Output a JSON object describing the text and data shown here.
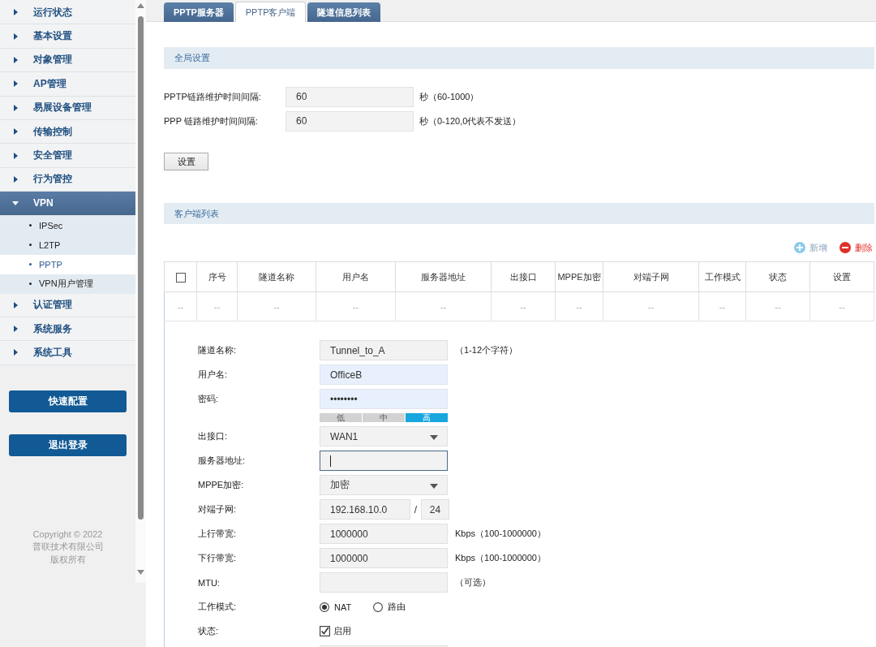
{
  "sidebar": {
    "items": [
      {
        "label": "运行状态",
        "expanded": false
      },
      {
        "label": "基本设置",
        "expanded": false
      },
      {
        "label": "对象管理",
        "expanded": false
      },
      {
        "label": "AP管理",
        "expanded": false
      },
      {
        "label": "易展设备管理",
        "expanded": false
      },
      {
        "label": "传输控制",
        "expanded": false
      },
      {
        "label": "安全管理",
        "expanded": false
      },
      {
        "label": "行为管控",
        "expanded": false
      },
      {
        "label": "VPN",
        "expanded": true,
        "children": [
          {
            "label": "IPSec",
            "selected": false
          },
          {
            "label": "L2TP",
            "selected": false
          },
          {
            "label": "PPTP",
            "selected": true
          },
          {
            "label": "VPN用户管理",
            "selected": false
          }
        ]
      },
      {
        "label": "认证管理",
        "expanded": false
      },
      {
        "label": "系统服务",
        "expanded": false
      },
      {
        "label": "系统工具",
        "expanded": false
      }
    ],
    "buttons": [
      "快速配置",
      "退出登录"
    ],
    "copyright": [
      "Copyright © 2022",
      "普联技术有限公司",
      "版权所有"
    ]
  },
  "tabs": [
    {
      "label": "PPTP服务器",
      "selected": false
    },
    {
      "label": "PPTP客户端",
      "selected": true
    },
    {
      "label": "隧道信息列表",
      "selected": false
    }
  ],
  "global_settings": {
    "title": "全局设置",
    "fields": [
      {
        "label": "PPTP链路维护时间间隔:",
        "value": "60",
        "hint": "秒（60-1000）"
      },
      {
        "label": "PPP 链路维护时间间隔:",
        "value": "60",
        "hint": "秒（0-120,0代表不发送）"
      }
    ],
    "button": "设置"
  },
  "client_list": {
    "title": "客户端列表",
    "actions": [
      {
        "kind": "add",
        "label": "新增"
      },
      {
        "kind": "delete",
        "label": "删除"
      }
    ],
    "table": {
      "select_all_checked": false,
      "columns": [
        "序号",
        "隧道名称",
        "用户名",
        "服务器地址",
        "出接口",
        "MPPE加密",
        "对端子网",
        "工作模式",
        "状态",
        "设置"
      ],
      "rows": [
        {
          "check_cell": "--",
          "cells": [
            "--",
            "--",
            "--",
            "--",
            "--",
            "--",
            "--",
            "--",
            "--",
            "--"
          ]
        }
      ]
    },
    "edit_form": {
      "fields": [
        {
          "kind": "text",
          "label": "隧道名称:",
          "value": "Tunnel_to_A",
          "hint": "（1-12个字符）",
          "autofilled": false,
          "focused": false
        },
        {
          "kind": "text",
          "label": "用户名:",
          "value": "OfficeB",
          "autofilled": true,
          "focused": false
        },
        {
          "kind": "password",
          "label": "密码:",
          "value": "••••••••",
          "autofilled": true,
          "focused": false,
          "strength": [
            {
              "label": "低",
              "selected": false
            },
            {
              "label": "中",
              "selected": false
            },
            {
              "label": "高",
              "selected": true
            }
          ]
        },
        {
          "kind": "select",
          "label": "出接口:",
          "value": "WAN1"
        },
        {
          "kind": "text",
          "label": "服务器地址:",
          "autofilled": false,
          "focused": true
        },
        {
          "kind": "select",
          "label": "MPPE加密:",
          "value": "加密"
        },
        {
          "kind": "subnet",
          "label": "对端子网:",
          "value": "192.168.10.0",
          "separator": "/",
          "mask": "24"
        },
        {
          "kind": "text",
          "label": "上行带宽:",
          "value": "1000000",
          "hint": "Kbps（100-1000000）",
          "autofilled": false,
          "focused": false
        },
        {
          "kind": "text",
          "label": "下行带宽:",
          "value": "1000000",
          "hint": "Kbps（100-1000000）",
          "autofilled": false,
          "focused": false
        },
        {
          "kind": "text",
          "label": "MTU:",
          "hint": "（可选）",
          "autofilled": false,
          "focused": false
        },
        {
          "kind": "radio",
          "label": "工作模式:",
          "options": [
            {
              "label": "NAT",
              "selected": true
            },
            {
              "label": "路由",
              "selected": false
            }
          ]
        },
        {
          "kind": "checkbox",
          "label": "状态:",
          "checked": true,
          "text": "启用"
        },
        {
          "kind": "text"
        }
      ]
    }
  }
}
